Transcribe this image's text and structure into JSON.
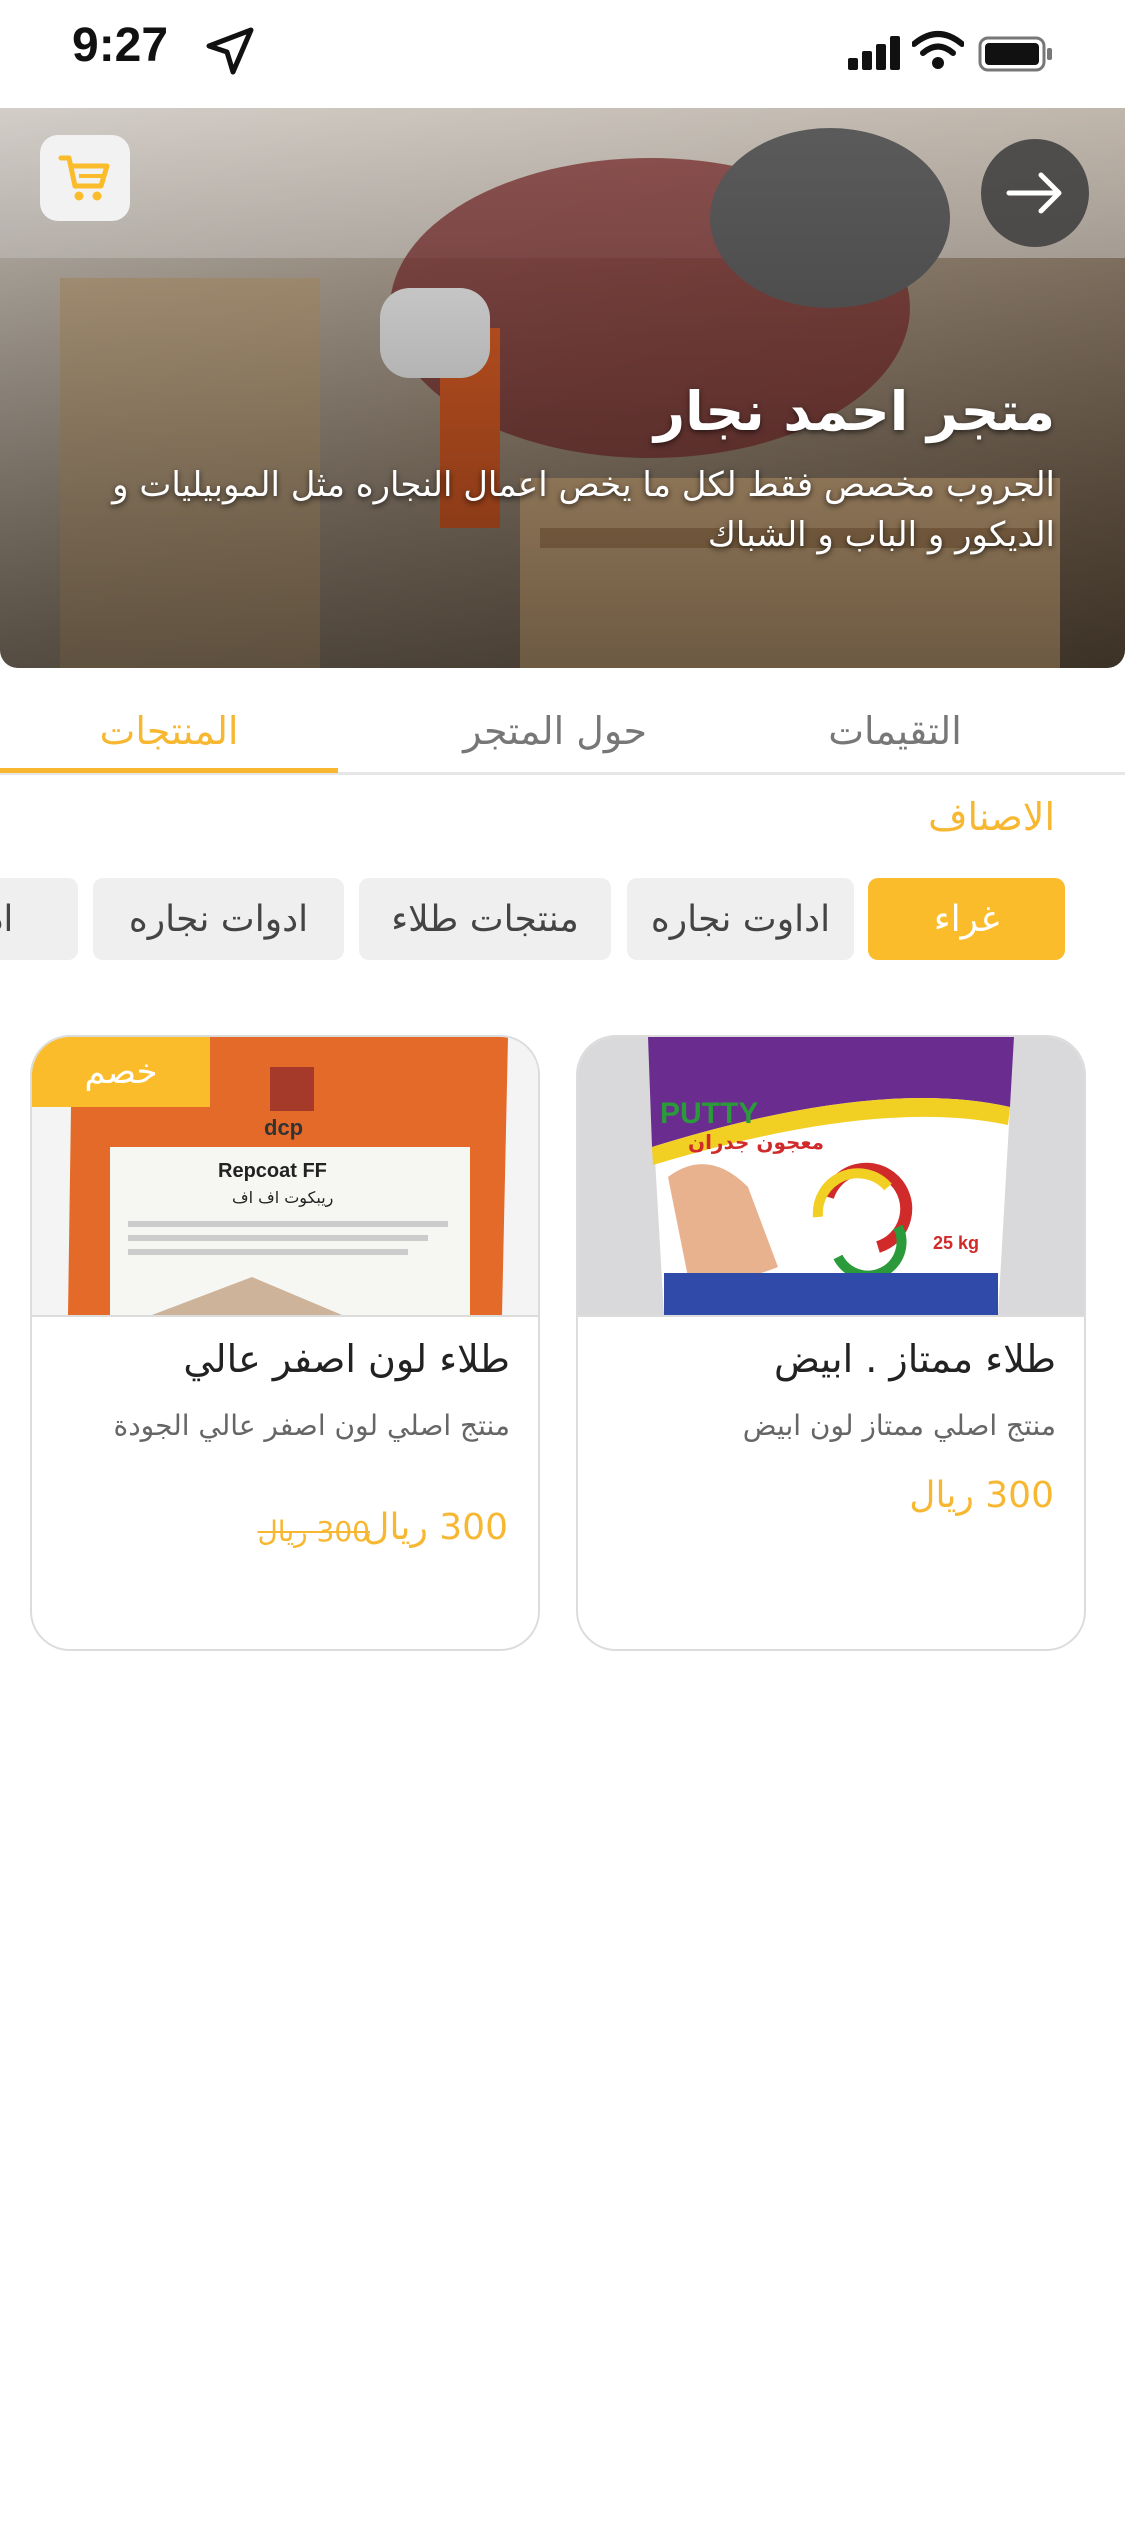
{
  "status_bar": {
    "time": "9:27"
  },
  "hero": {
    "store_name": "متجر احمد نجار",
    "description": "الجروب مخصص فقط لكل ما يخص اعمال النجاره مثل الموبيليات و الديكور و الباب و الشباك"
  },
  "tabs": [
    {
      "label": "المنتجات",
      "active": true
    },
    {
      "label": "حول المتجر",
      "active": false
    },
    {
      "label": "التقيمات",
      "active": false
    }
  ],
  "categories": {
    "title": "الاصناف",
    "items": [
      {
        "label": "غراء",
        "active": true
      },
      {
        "label": "اداوت نجاره",
        "active": false
      },
      {
        "label": "منتجات طلاء",
        "active": false
      },
      {
        "label": "ادوات  نجاره",
        "active": false
      },
      {
        "label": "ادوا",
        "active": false
      }
    ]
  },
  "products": [
    {
      "title": "طلاء ممتاز . ابيض",
      "description": "منتج اصلي ممتاز لون ابيض",
      "price": "300 ريال",
      "image_text": [
        "PUTTY",
        "معجون جدران",
        "25 kg"
      ]
    },
    {
      "title": "طلاء لون اصفر عالي",
      "description": "منتج اصلي لون اصفر عالي الجودة",
      "price": "300 ريال",
      "old_price": "300 ريال",
      "badge": "خصم",
      "image_text": [
        "dcp",
        "Repcoat FF",
        "ريبكوت اف اف"
      ]
    }
  ],
  "colors": {
    "accent": "#f7b731",
    "chip_active": "#fbbc2c"
  }
}
